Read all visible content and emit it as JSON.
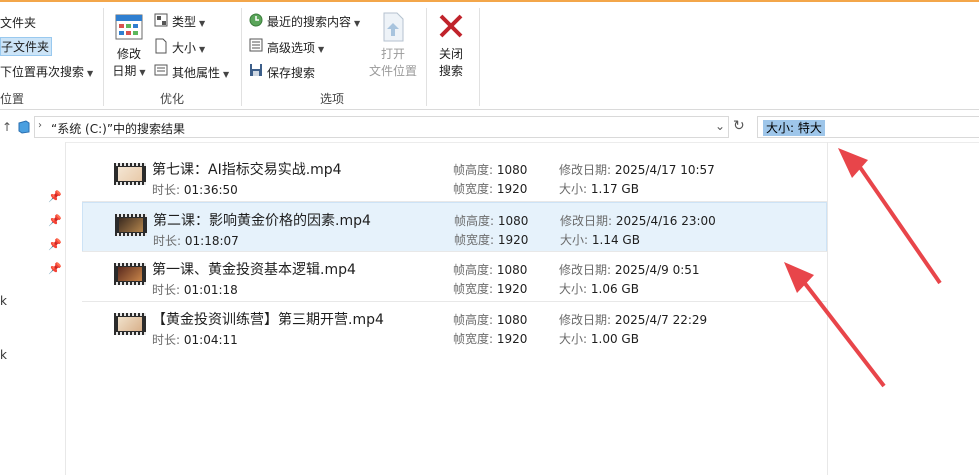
{
  "ribbon": {
    "location_group": {
      "item1": "文件夹",
      "item2": "子文件夹",
      "item3": "下位置再次搜索",
      "label": "位置"
    },
    "optimize_group": {
      "modify_date": "修改",
      "modify_date_line2": "日期",
      "type": "类型",
      "size": "大小",
      "other_props": "其他属性",
      "label": "优化"
    },
    "options_group": {
      "recent_searches": "最近的搜索内容",
      "advanced_options": "高级选项",
      "save_search": "保存搜索",
      "open_location": "打开",
      "open_location_line2": "文件位置",
      "label": "选项"
    },
    "close_search": "关闭",
    "close_search_line2": "搜索"
  },
  "address": {
    "path": "“系统 (C:)”中的搜索结果"
  },
  "search": {
    "value": "大小: 特大"
  },
  "files": [
    {
      "name": "第七课：AI指标交易实战.mp4",
      "duration_label": "时长:",
      "duration": "01:36:50",
      "height_label": "帧高度:",
      "height": "1080",
      "width_label": "帧宽度:",
      "width": "1920",
      "date_label": "修改日期:",
      "date": "2025/4/17 10:57",
      "size_label": "大小:",
      "size": "1.17 GB"
    },
    {
      "name": "第二课：影响黄金价格的因素.mp4",
      "duration_label": "时长:",
      "duration": "01:18:07",
      "height_label": "帧高度:",
      "height": "1080",
      "width_label": "帧宽度:",
      "width": "1920",
      "date_label": "修改日期:",
      "date": "2025/4/16 23:00",
      "size_label": "大小:",
      "size": "1.14 GB"
    },
    {
      "name": "第一课、黄金投资基本逻辑.mp4",
      "duration_label": "时长:",
      "duration": "01:01:18",
      "height_label": "帧高度:",
      "height": "1080",
      "width_label": "帧宽度:",
      "width": "1920",
      "date_label": "修改日期:",
      "date": "2025/4/9 0:51",
      "size_label": "大小:",
      "size": "1.06 GB"
    },
    {
      "name": "【黄金投资训练营】第三期开营.mp4",
      "duration_label": "时长:",
      "duration": "01:04:11",
      "height_label": "帧高度:",
      "height": "1080",
      "width_label": "帧宽度:",
      "width": "1920",
      "date_label": "修改日期:",
      "date": "2025/4/7 22:29",
      "size_label": "大小:",
      "size": "1.00 GB"
    }
  ],
  "nav_fragments": {
    "f1": "k",
    "f2": "k"
  },
  "colors": {
    "selection": "#e6f2fb",
    "search_highlight": "#9ec6ea",
    "annotation_arrow": "#e8454a",
    "close_x": "#c0232b"
  }
}
